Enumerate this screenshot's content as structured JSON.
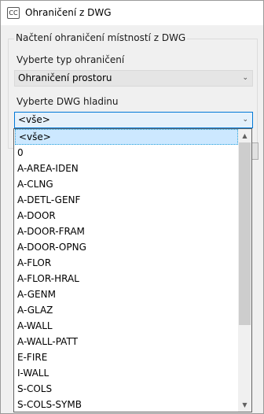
{
  "window": {
    "icon_text": "CC",
    "title": "Ohraničení z DWG"
  },
  "group": {
    "legend": "Načtení ohraničení místností z DWG",
    "type_label": "Vyberte typ ohraničení",
    "type_value": "Ohraničení prostoru",
    "layer_label": "Vyberte DWG hladinu",
    "layer_value": "<vše>"
  },
  "dropdown": {
    "items": [
      "<vše>",
      "0",
      "A-AREA-IDEN",
      "A-CLNG",
      "A-DETL-GENF",
      "A-DOOR",
      "A-DOOR-FRAM",
      "A-DOOR-OPNG",
      "A-FLOR",
      "A-FLOR-HRAL",
      "A-GENM",
      "A-GLAZ",
      "A-WALL",
      "A-WALL-PATT",
      "E-FIRE",
      "I-WALL",
      "S-COLS",
      "S-COLS-SYMB"
    ],
    "selected_index": 0
  },
  "icons": {
    "combo_arrow": "chevron-down-icon",
    "scroll_up": "scroll-up-arrow-icon",
    "scroll_down": "scroll-down-arrow-icon"
  }
}
